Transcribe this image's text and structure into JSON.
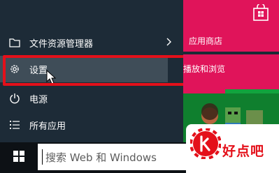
{
  "start_menu": {
    "items": [
      {
        "label": "文件资源管理器",
        "icon": "folder-icon",
        "has_submenu": true
      },
      {
        "label": "设置",
        "icon": "gear-icon",
        "has_submenu": false
      },
      {
        "label": "电源",
        "icon": "power-icon",
        "has_submenu": false
      },
      {
        "label": "所有应用",
        "icon": "list-icon",
        "has_submenu": false
      }
    ]
  },
  "tiles": {
    "store_label": "应用商店",
    "browse_label": "播放和浏览"
  },
  "taskbar": {
    "search_placeholder": "搜索 Web 和 Windows"
  },
  "watermark": {
    "text": "好点吧"
  },
  "colors": {
    "accent_tile": "#e0145a",
    "highlight_box": "#e4101a",
    "menu_bg": "#1d2b37"
  }
}
